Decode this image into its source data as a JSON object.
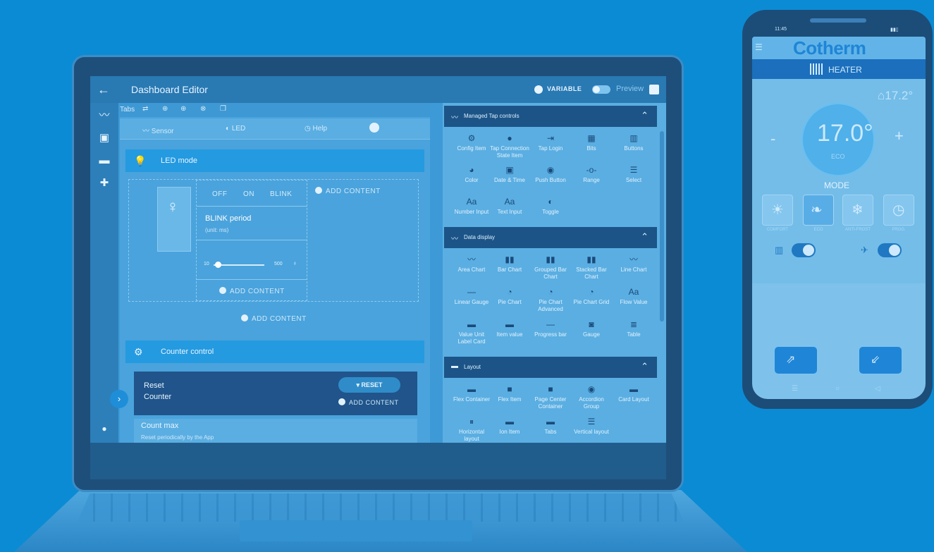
{
  "editor": {
    "title": "Dashboard Editor",
    "variable_label": "VARIABLE",
    "preview_label": "Preview",
    "tabs_label": "Tabs",
    "tabs": [
      {
        "label": "Sensor",
        "icon": "chart-line-icon"
      },
      {
        "label": "LED",
        "icon": "toggle-icon"
      },
      {
        "label": "Help",
        "icon": "help-circle-icon"
      }
    ],
    "led_section": {
      "title": "LED mode",
      "options": [
        "OFF",
        "ON",
        "BLINK"
      ],
      "blink_title": "BLINK period",
      "blink_unit": "(unit: ms)",
      "slider_min": "10",
      "slider_max": "500",
      "add_content": "ADD CONTENT"
    },
    "counter_section": {
      "title": "Counter control",
      "reset_label_line1": "Reset",
      "reset_label_line2": "Counter",
      "reset_button": "RESET",
      "add_content": "ADD CONTENT",
      "count_max_title": "Count max",
      "count_max_sub": "Reset periodically by the App"
    }
  },
  "palette": {
    "groups": [
      {
        "title": "Managed Tap controls",
        "items": [
          {
            "label": "Config Item",
            "glyph": "⚙"
          },
          {
            "label": "Tap Connection State Item",
            "glyph": "●"
          },
          {
            "label": "Tap Login",
            "glyph": "⇥"
          },
          {
            "label": "Bits",
            "glyph": "▦"
          },
          {
            "label": "Buttons",
            "glyph": "▥"
          },
          {
            "label": "Color",
            "glyph": "◕"
          },
          {
            "label": "Date & Time",
            "glyph": "▣"
          },
          {
            "label": "Push Button",
            "glyph": "◉"
          },
          {
            "label": "Range",
            "glyph": "-o-"
          },
          {
            "label": "Select",
            "glyph": "☰"
          },
          {
            "label": "Number Input",
            "glyph": "Aa"
          },
          {
            "label": "Text Input",
            "glyph": "Aa"
          },
          {
            "label": "Toggle",
            "glyph": "◐"
          }
        ]
      },
      {
        "title": "Data display",
        "items": [
          {
            "label": "Area Chart",
            "glyph": "〰"
          },
          {
            "label": "Bar Chart",
            "glyph": "▮▮"
          },
          {
            "label": "Grouped Bar Chart",
            "glyph": "▮▮"
          },
          {
            "label": "Stacked Bar Chart",
            "glyph": "▮▮"
          },
          {
            "label": "Line Chart",
            "glyph": "〰"
          },
          {
            "label": "Linear Gauge",
            "glyph": "—"
          },
          {
            "label": "Pie Chart",
            "glyph": "◔"
          },
          {
            "label": "Pie Chart Advanced",
            "glyph": "◔"
          },
          {
            "label": "Pie Chart Grid",
            "glyph": "◔"
          },
          {
            "label": "Flow Value",
            "glyph": "Aa"
          },
          {
            "label": "Value Unit Label Card",
            "glyph": "▬"
          },
          {
            "label": "Item value",
            "glyph": "▬"
          },
          {
            "label": "Progress bar",
            "glyph": "—"
          },
          {
            "label": "Gauge",
            "glyph": "◙"
          },
          {
            "label": "Table",
            "glyph": "≣"
          }
        ]
      },
      {
        "title": "Layout",
        "items": [
          {
            "label": "Flex Container",
            "glyph": "▬"
          },
          {
            "label": "Flex Item",
            "glyph": "■"
          },
          {
            "label": "Page Center Container",
            "glyph": "■"
          },
          {
            "label": "Accordion Group",
            "glyph": "◉"
          },
          {
            "label": "Card Layout",
            "glyph": "▬"
          },
          {
            "label": "Horizontal layout",
            "glyph": "⏸"
          },
          {
            "label": "Ion Item",
            "glyph": "▬"
          },
          {
            "label": "Tabs",
            "glyph": "▬"
          },
          {
            "label": "Vertical layout",
            "glyph": "☰"
          }
        ]
      }
    ]
  },
  "phone": {
    "status_time": "11:45",
    "brand": "Cotherm",
    "device_label": "HEATER",
    "room_temp": "⌂17.2°",
    "set_temp": "17.0°",
    "set_mode": "ECO",
    "minus": "-",
    "plus": "+",
    "mode_title": "MODE",
    "modes": [
      "COMFORT",
      "ECO",
      "ANTI-FROST",
      "PROG."
    ]
  },
  "colors": {
    "background": "#0b8bd4",
    "accent": "#249ae0",
    "dark_panel": "#1c5487"
  }
}
